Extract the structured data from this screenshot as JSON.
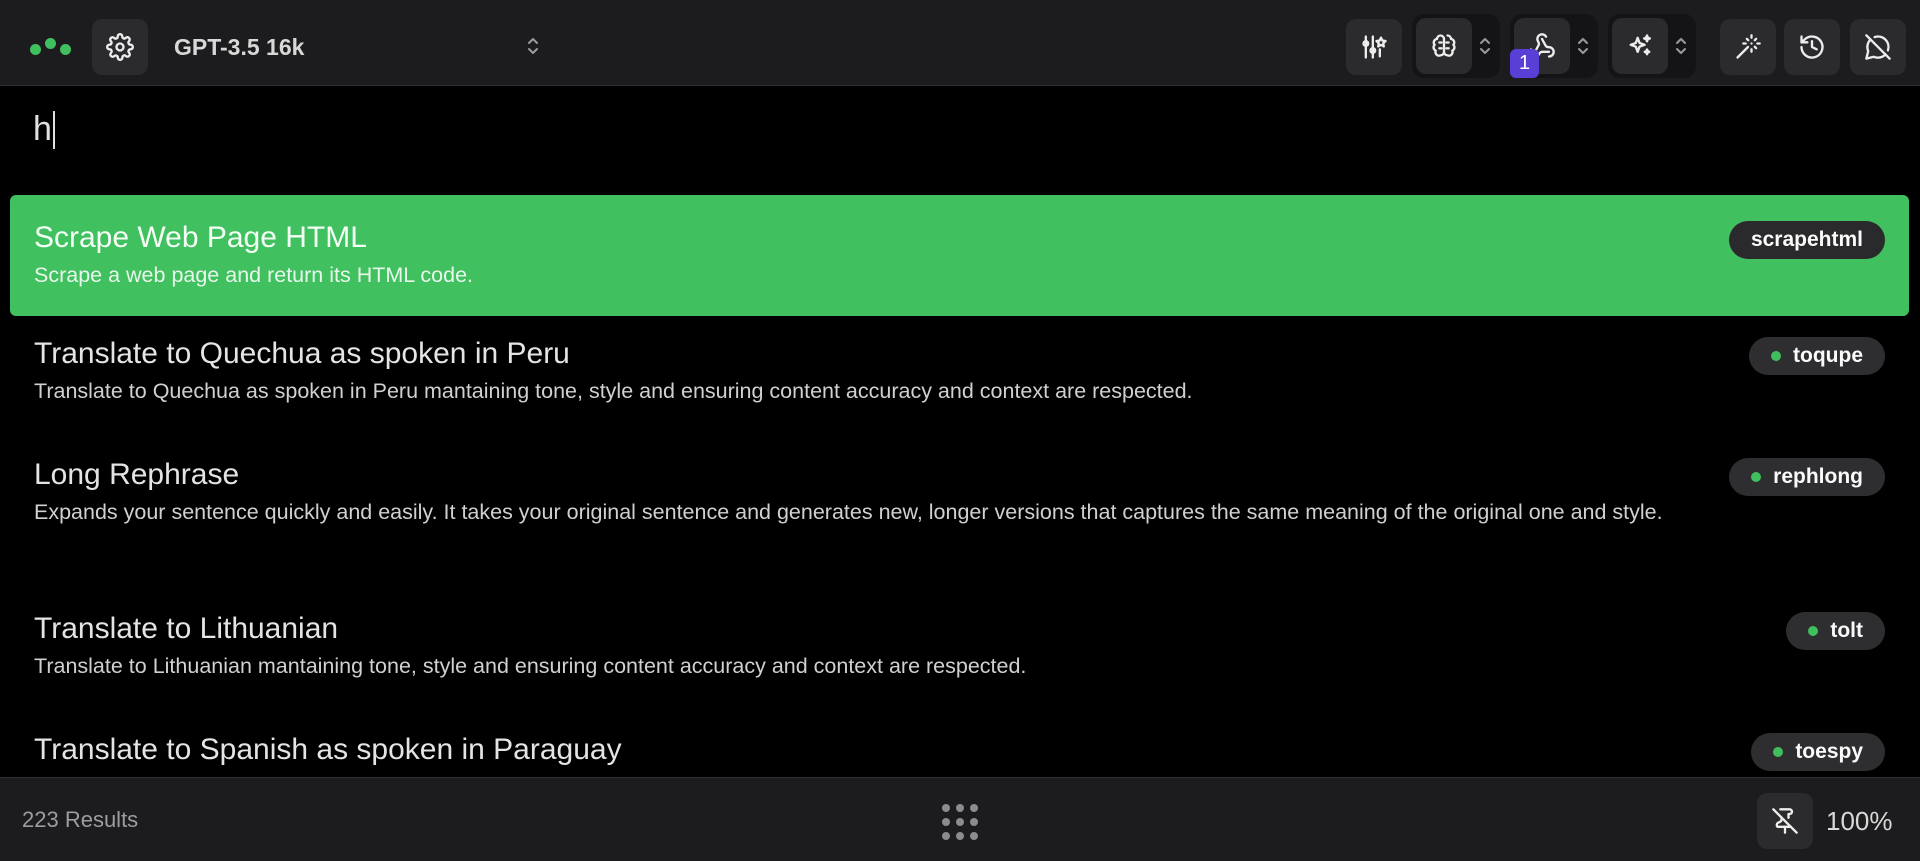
{
  "header": {
    "model_name": "GPT-3.5 16k",
    "notification_count": "1",
    "icons": [
      "app-logo",
      "settings-icon",
      "sliders-icon",
      "brain-icon",
      "webhook-icon",
      "sparkles-icon",
      "magic-wand-icon",
      "history-icon",
      "message-off-icon"
    ]
  },
  "search": {
    "value": "h"
  },
  "results": [
    {
      "title": "Scrape Web Page HTML",
      "description": "Scrape a web page and return its HTML code.",
      "tag": "scrapehtml",
      "selected": true
    },
    {
      "title": "Translate to Quechua as spoken in Peru",
      "description": "Translate to Quechua as spoken in Peru mantaining tone, style and ensuring content accuracy and context are respected.",
      "tag": "toqupe"
    },
    {
      "title": "Long Rephrase",
      "description": "Expands your sentence quickly and easily. It takes your original sentence and generates new, longer versions that captures the same meaning of the original one and style.",
      "tag": "rephlong"
    },
    {
      "title": "Translate to Lithuanian",
      "description": "Translate to Lithuanian mantaining tone, style and ensuring content accuracy and context are respected.",
      "tag": "tolt"
    },
    {
      "title": "Translate to Spanish as spoken in Paraguay",
      "description": "",
      "tag": "toespy"
    }
  ],
  "footer": {
    "results_count": "223 Results",
    "zoom": "100%"
  },
  "colors": {
    "accent": "#40c05e",
    "badge": "#5a3fd6",
    "bar_background": "#1c1c1e",
    "tag_background": "#2e2e31"
  }
}
